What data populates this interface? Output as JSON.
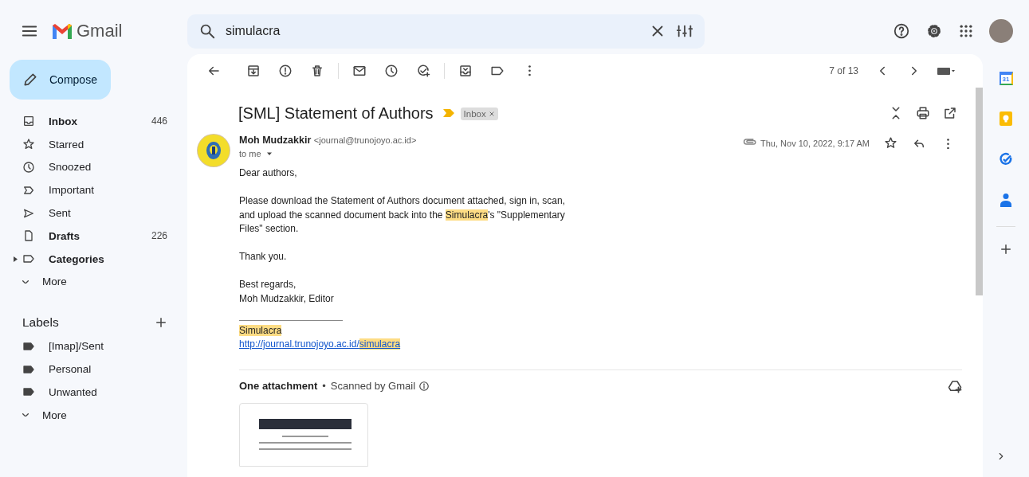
{
  "app": {
    "name": "Gmail"
  },
  "search": {
    "value": "simulacra"
  },
  "compose": {
    "label": "Compose"
  },
  "sidebar": {
    "items": [
      {
        "kind": "folder",
        "label": "Inbox",
        "count": "446",
        "unread": true
      },
      {
        "kind": "folder",
        "label": "Starred",
        "unread": false
      },
      {
        "kind": "folder",
        "label": "Snoozed",
        "unread": false
      },
      {
        "kind": "folder",
        "label": "Important",
        "unread": false
      },
      {
        "kind": "folder",
        "label": "Sent",
        "unread": false
      },
      {
        "kind": "folder",
        "label": "Drafts",
        "count": "226",
        "unread": true
      },
      {
        "kind": "group",
        "label": "Categories",
        "unread": true
      },
      {
        "kind": "more",
        "label": "More",
        "unread": false
      }
    ],
    "labels_heading": "Labels",
    "labels": [
      {
        "kind": "label",
        "label": "[Imap]/Sent"
      },
      {
        "kind": "label",
        "label": "Personal"
      },
      {
        "kind": "label",
        "label": "Unwanted"
      },
      {
        "kind": "more",
        "label": "More"
      }
    ]
  },
  "pager": {
    "text": "7 of 13"
  },
  "subject": {
    "text": "[SML] Statement of Authors",
    "important": true,
    "tags": [
      {
        "label": "Inbox"
      }
    ]
  },
  "message": {
    "sender_name": "Moh Mudzakkir",
    "sender_email": "<journal@trunojoyo.ac.id>",
    "recipient": "to me",
    "date": "Thu, Nov 10, 2022, 9:17 AM",
    "has_attachment": true,
    "starred": false,
    "paragraphs": [
      {
        "lines": [
          {
            "kind": "text",
            "segments": [
              {
                "text": "Dear authors,",
                "highlight": false
              }
            ]
          }
        ]
      },
      {
        "lines": [
          {
            "kind": "text",
            "segments": [
              {
                "text": "Please download the Statement of Authors document attached, sign in, scan, and upload the scanned document back into the ",
                "highlight": false
              },
              {
                "text": "Simulacra",
                "highlight": true
              },
              {
                "text": "'s \"Supplementary Files\" section.",
                "highlight": false
              }
            ]
          }
        ]
      },
      {
        "lines": [
          {
            "kind": "text",
            "segments": [
              {
                "text": "Thank you.",
                "highlight": false
              }
            ]
          }
        ]
      },
      {
        "lines": [
          {
            "kind": "text",
            "segments": [
              {
                "text": "Best regards,",
                "highlight": false
              }
            ]
          },
          {
            "kind": "text",
            "segments": [
              {
                "text": "Moh Mudzakkir, Editor",
                "highlight": false
              }
            ]
          }
        ]
      }
    ],
    "signature": [
      {
        "kind": "text",
        "segments": [
          {
            "text": "Simulacra",
            "highlight": true
          }
        ]
      },
      {
        "kind": "link",
        "segments": [
          {
            "text": "http://journal.trunojoyo.ac.id/",
            "highlight": false
          },
          {
            "text": "simulacra",
            "highlight": true
          }
        ]
      }
    ]
  },
  "attachments": {
    "title": "One attachment",
    "separator": "•",
    "note": "Scanned by Gmail"
  },
  "rail": {
    "calendar_day": "31"
  }
}
